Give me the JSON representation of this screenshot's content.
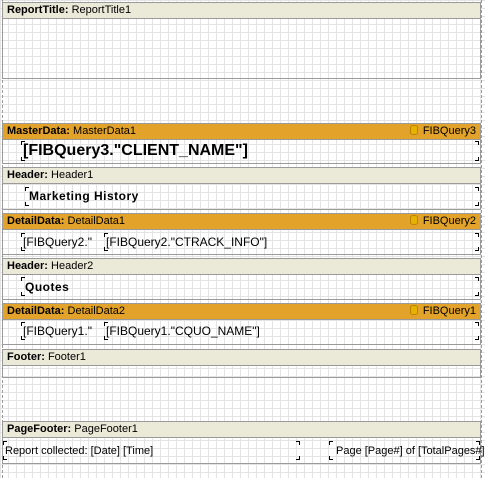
{
  "bands": {
    "report_title": {
      "kind": "ReportTitle:",
      "name": "ReportTitle1"
    },
    "master_data": {
      "kind": "MasterData:",
      "name": "MasterData1",
      "dataset": "FIBQuery3",
      "memo": "[FIBQuery3.\"CLIENT_NAME\"]"
    },
    "header1": {
      "kind": "Header:",
      "name": "Header1",
      "memo": "Marketing History"
    },
    "detail1": {
      "kind": "DetailData:",
      "name": "DetailData1",
      "dataset": "FIBQuery2",
      "memo_a": "[FIBQuery2.\"",
      "memo_b": "[FIBQuery2.\"CTRACK_INFO\"]"
    },
    "header2": {
      "kind": "Header:",
      "name": "Header2",
      "memo": "Quotes"
    },
    "detail2": {
      "kind": "DetailData:",
      "name": "DetailData2",
      "dataset": "FIBQuery1",
      "memo_a": "[FIBQuery1.\"",
      "memo_b": "[FIBQuery1.\"CQUO_NAME\"]"
    },
    "footer": {
      "kind": "Footer:",
      "name": "Footer1"
    },
    "page_footer": {
      "kind": "PageFooter:",
      "name": "PageFooter1",
      "memo_left": "Report collected: [Date]  [Time]",
      "memo_right": "Page [Page#] of [TotalPages#]"
    }
  },
  "colors": {
    "header_band": "#ebe9d8",
    "data_band": "#e3a32a",
    "grid": "#e4e4e4"
  },
  "icons": {
    "dataset": "database-icon"
  }
}
